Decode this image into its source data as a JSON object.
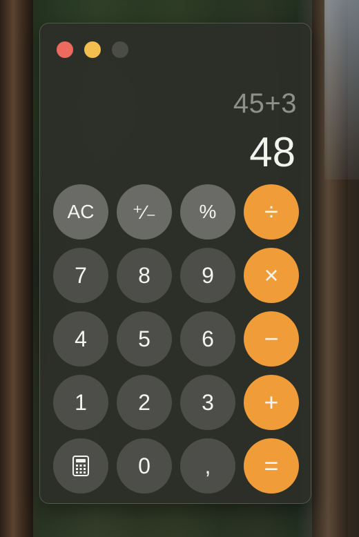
{
  "window": {
    "traffic_lights": [
      "close",
      "minimize",
      "zoom"
    ]
  },
  "display": {
    "expression": "45+3",
    "result": "48"
  },
  "keys": {
    "ac": "AC",
    "plus_minus": "⁺∕₋",
    "percent": "%",
    "divide": "÷",
    "seven": "7",
    "eight": "8",
    "nine": "9",
    "multiply": "×",
    "four": "4",
    "five": "5",
    "six": "6",
    "minus": "−",
    "one": "1",
    "two": "2",
    "three": "3",
    "plus": "+",
    "zero": "0",
    "decimal": ",",
    "equals": "="
  },
  "icons": {
    "mode": "calculator-icon"
  },
  "colors": {
    "operator": "#f09c38",
    "function_key": "#6a6b66",
    "number_key": "#4d4e4a"
  }
}
